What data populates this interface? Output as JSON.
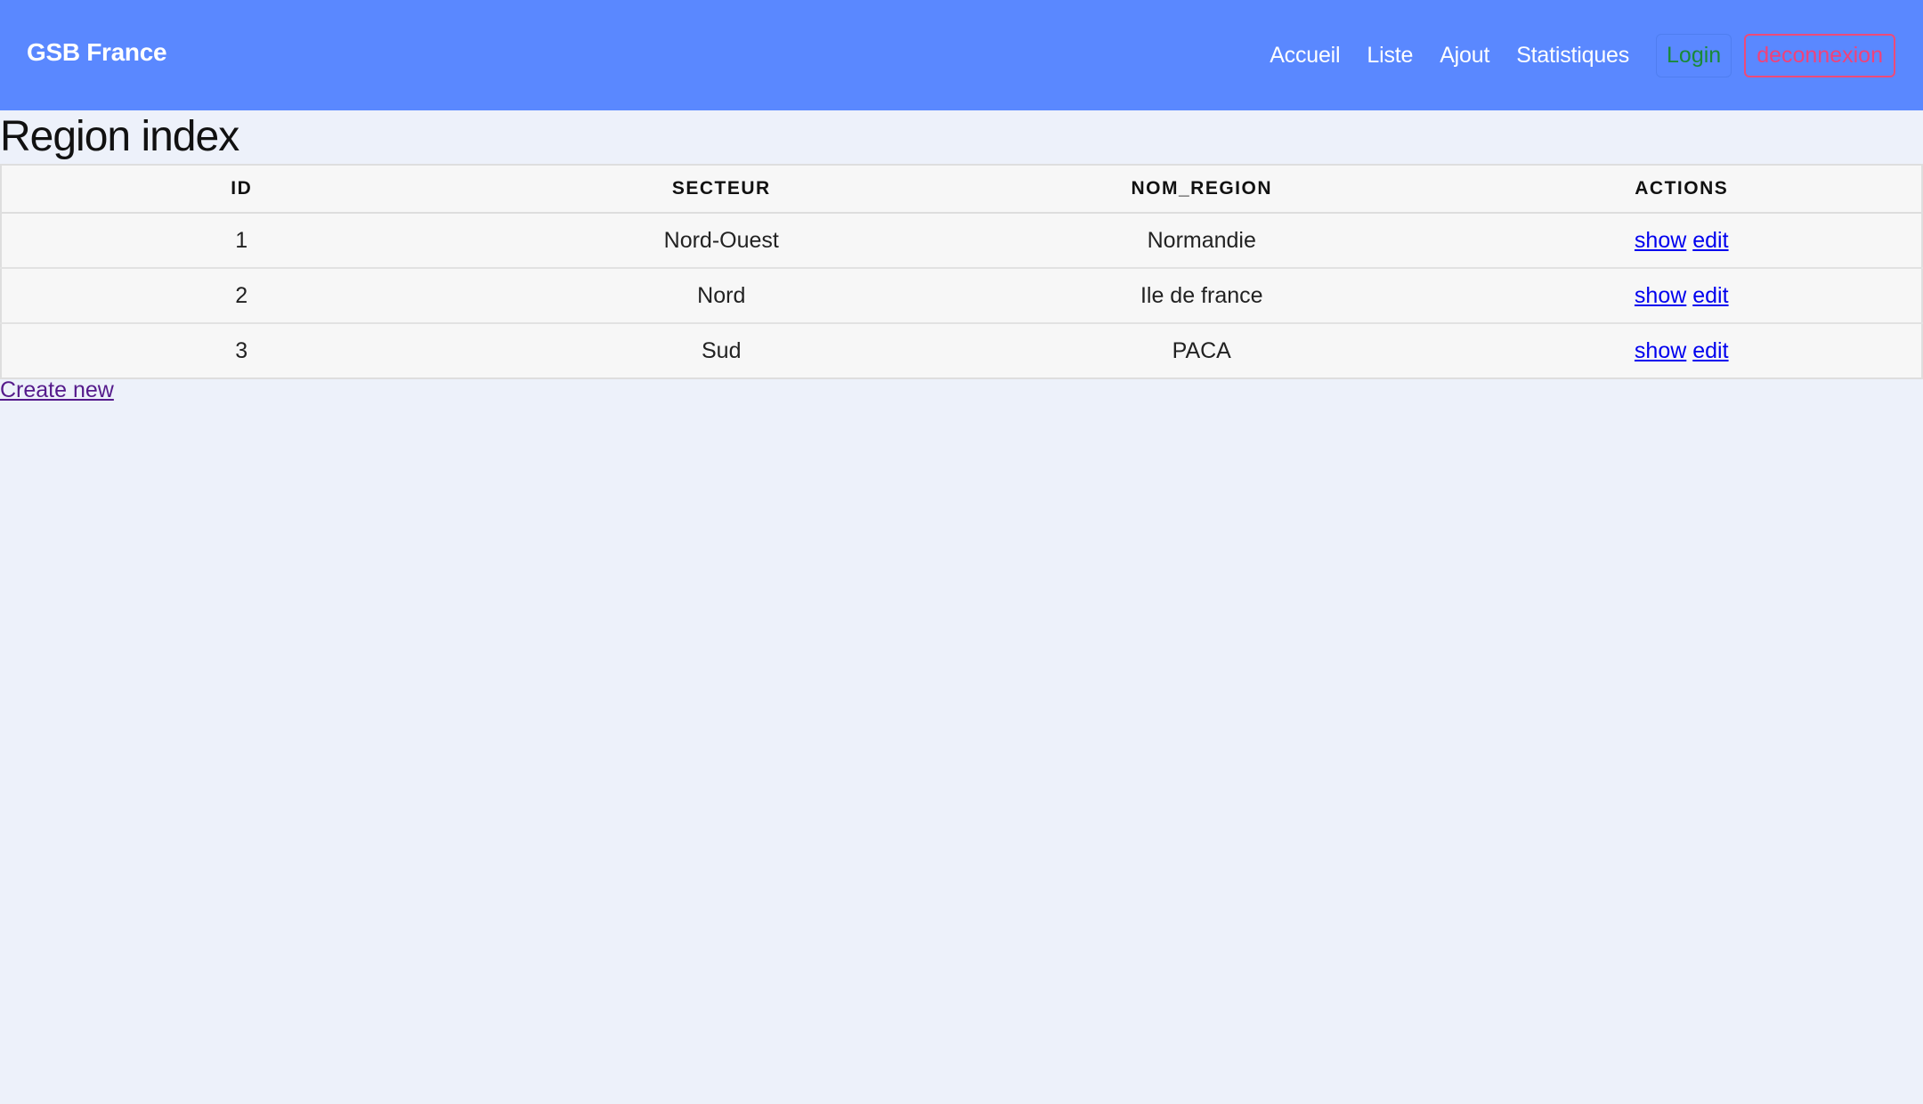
{
  "navbar": {
    "brand": "GSB France",
    "links": [
      {
        "label": "Accueil"
      },
      {
        "label": "Liste"
      },
      {
        "label": "Ajout"
      },
      {
        "label": "Statistiques"
      }
    ],
    "login_label": "Login",
    "logout_label": "deconnexion",
    "colors": {
      "background": "#5a88ff",
      "login": "#198a38",
      "logout": "#f0427a"
    }
  },
  "page": {
    "title": "Region index",
    "create_new_label": "Create new"
  },
  "table": {
    "columns": [
      "ID",
      "SECTEUR",
      "NOM_REGION",
      "ACTIONS"
    ],
    "rows": [
      {
        "id": "1",
        "secteur": "Nord-Ouest",
        "nom_region": "Normandie",
        "show": "show",
        "edit": "edit"
      },
      {
        "id": "2",
        "secteur": "Nord",
        "nom_region": "Ile de france",
        "show": "show",
        "edit": "edit"
      },
      {
        "id": "3",
        "secteur": "Sud",
        "nom_region": "PACA",
        "show": "show",
        "edit": "edit"
      }
    ]
  }
}
